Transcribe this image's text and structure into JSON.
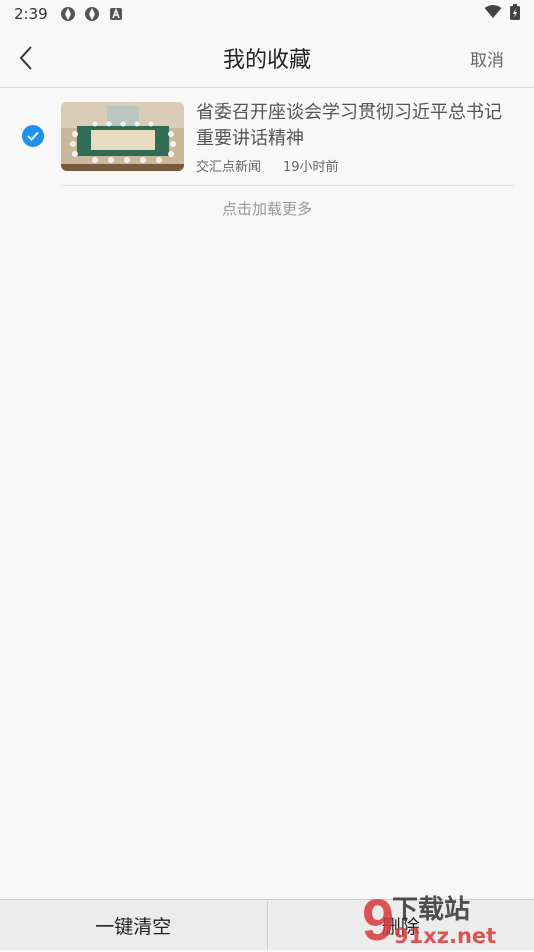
{
  "status_bar": {
    "time": "2:39"
  },
  "header": {
    "title": "我的收藏",
    "cancel": "取消"
  },
  "items": [
    {
      "title": "省委召开座谈会学习贯彻习近平总书记重要讲话精神",
      "source": "交汇点新闻",
      "time": "19小时前",
      "checked": true
    }
  ],
  "load_more": "点击加载更多",
  "footer": {
    "clear_all": "一键清空",
    "delete": "删除"
  },
  "watermark": {
    "brand_text": "下载站",
    "url": "91xz.net"
  },
  "colors": {
    "accent": "#1e90f0",
    "background": "#f8f8f8"
  }
}
